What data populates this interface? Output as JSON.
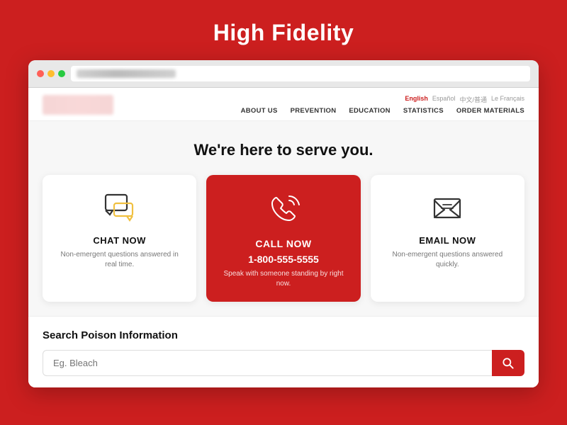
{
  "page": {
    "title": "High Fidelity",
    "background_color": "#cc1f1f"
  },
  "nav": {
    "lang_items": [
      {
        "label": "English",
        "active": true
      },
      {
        "label": "Español",
        "active": false
      },
      {
        "label": "中文/普通",
        "active": false
      },
      {
        "label": "Le Français",
        "active": false
      }
    ],
    "links": [
      "ABOUT US",
      "PREVENTION",
      "EDUCATION",
      "STATISTICS",
      "ORDER MATERIALS"
    ]
  },
  "hero": {
    "title": "We're here to serve you."
  },
  "cards": [
    {
      "id": "chat",
      "title": "CHAT NOW",
      "description": "Non-emergent questions answered in real time.",
      "center": false
    },
    {
      "id": "call",
      "title": "CALL NOW",
      "phone": "1-800-555-5555",
      "description": "Speak with someone standing by right now.",
      "center": true
    },
    {
      "id": "email",
      "title": "EMAIL NOW",
      "description": "Non-emergent questions answered quickly.",
      "center": false
    }
  ],
  "search": {
    "section_title": "Search Poison Information",
    "placeholder": "Eg. Bleach"
  }
}
